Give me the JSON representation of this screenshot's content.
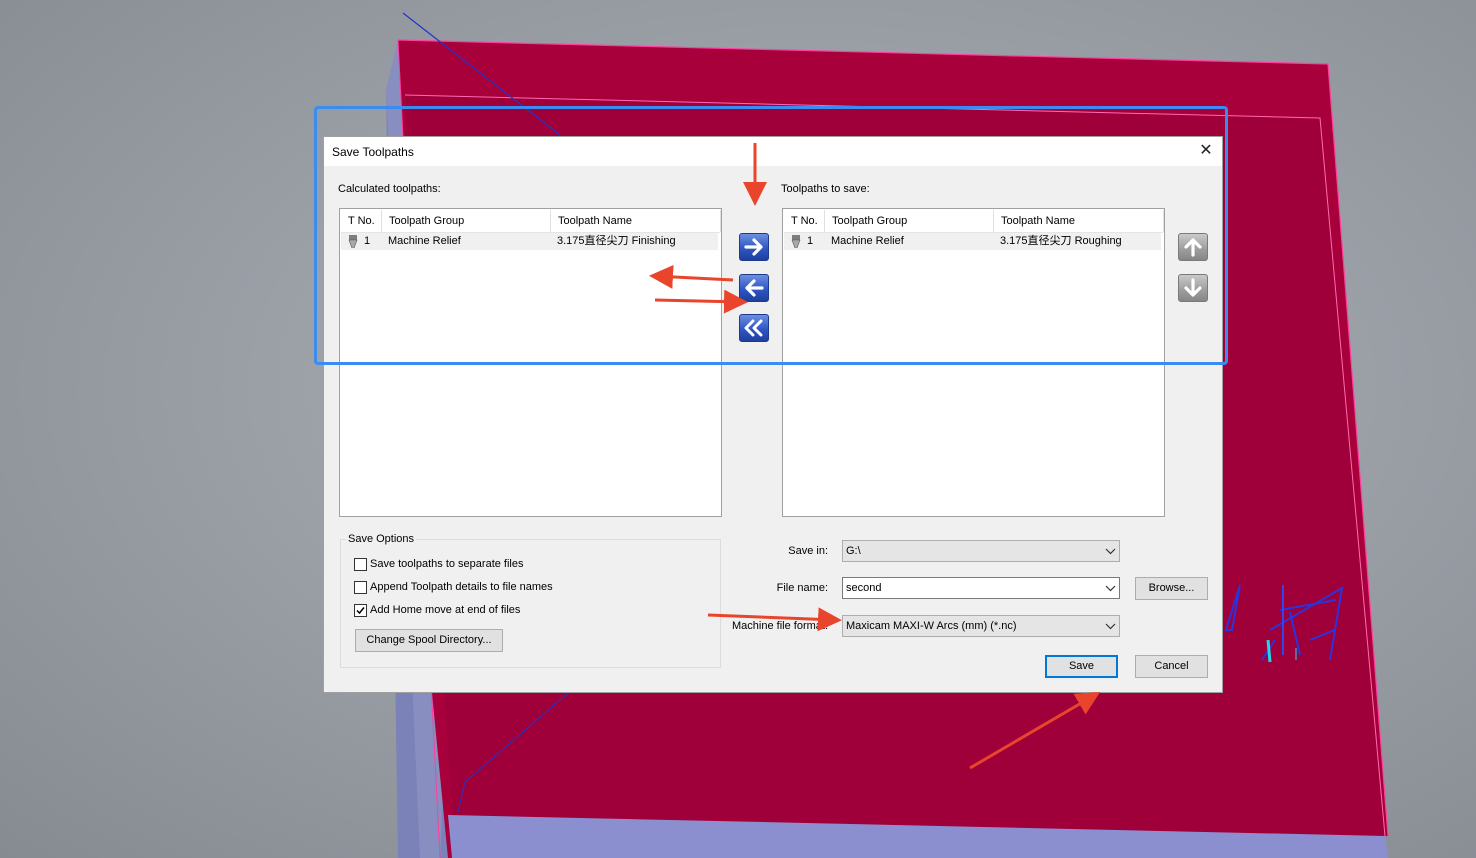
{
  "window": {
    "title": "Save Toolpaths",
    "close_glyph": "✕"
  },
  "left_panel": {
    "label": "Calculated toolpaths:",
    "columns": [
      "T No.",
      "Toolpath Group",
      "Toolpath Name"
    ],
    "rows": [
      {
        "tno": "1",
        "group": "Machine Relief",
        "name": "3.175直径尖刀 Finishing"
      }
    ]
  },
  "right_panel": {
    "label": "Toolpaths to save:",
    "columns": [
      "T No.",
      "Toolpath Group",
      "Toolpath Name"
    ],
    "rows": [
      {
        "tno": "1",
        "group": "Machine Relief",
        "name": "3.175直径尖刀 Roughing"
      }
    ]
  },
  "transfer_buttons": [
    "arrow-right-icon",
    "arrow-left-icon",
    "double-arrow-left-icon"
  ],
  "order_buttons": [
    "arrow-up-icon",
    "arrow-down-icon"
  ],
  "save_options": {
    "label": "Save Options",
    "separate_files": {
      "label": "Save toolpaths to separate files",
      "checked": false
    },
    "append_details": {
      "label": "Append Toolpath details to file names",
      "checked": false
    },
    "home_move": {
      "label": "Add Home move at end of files",
      "checked": true
    },
    "spool_button": "Change Spool Directory..."
  },
  "save_in": {
    "label": "Save in:",
    "value": "G:\\"
  },
  "file_name": {
    "label": "File name:",
    "value": "second"
  },
  "browse_button": "Browse...",
  "format": {
    "label": "Machine file format:",
    "value": "Maxicam MAXI-W Arcs (mm) (*.nc)"
  },
  "save_button": "Save",
  "cancel_button": "Cancel",
  "colors": {
    "annotation_arrow": "#e8452c",
    "highlight_box": "#3b8cf0",
    "relief_surface": "#a8003a",
    "accent_blue": "#2f56c4"
  }
}
